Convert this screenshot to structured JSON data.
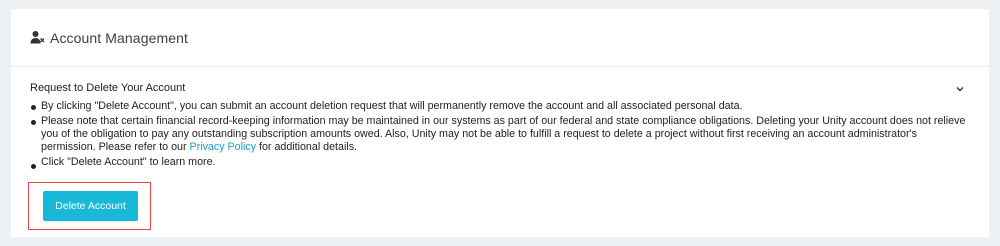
{
  "header": {
    "title": "Account Management",
    "icon": "user-remove-icon"
  },
  "section": {
    "title": "Request to Delete Your Account",
    "toggle_icon": "chevron-down-icon",
    "bullets": {
      "b1": "By clicking \"Delete Account\", you can submit an account deletion request that will permanently remove the account and all associated personal data.",
      "b2_before": "Please note that certain financial record-keeping information may be maintained in our systems as part of our federal and state compliance obligations. Deleting your Unity account does not relieve you of the obligation to pay any outstanding subscription amounts owed. Also, Unity may not be able to fulfill a request to delete a project without first receiving an account administrator's permission. Please refer to our ",
      "b2_link": "Privacy Policy",
      "b2_after": " for additional details.",
      "b3": "Click \"Delete Account\" to learn more."
    }
  },
  "actions": {
    "delete_label": "Delete Account"
  },
  "colors": {
    "accent": "#1ab8d8",
    "link": "#1a9ad6",
    "highlight": "#e14545",
    "background": "#eef1f4"
  }
}
